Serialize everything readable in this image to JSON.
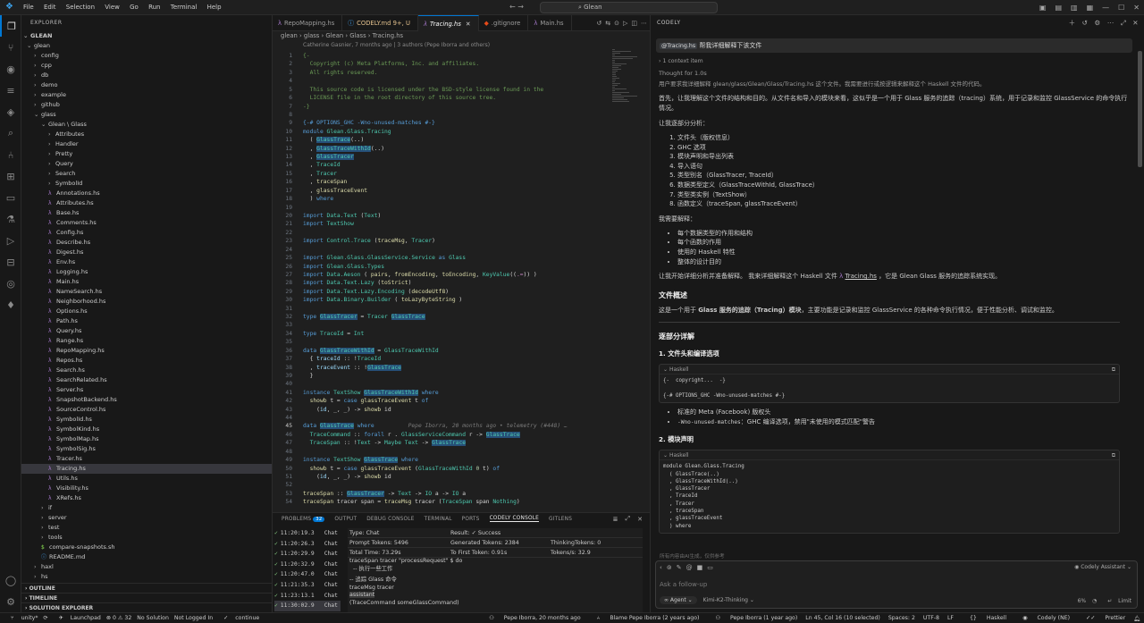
{
  "titlebar": {
    "menu": [
      "File",
      "Edit",
      "Selection",
      "View",
      "Go",
      "Run",
      "Terminal",
      "Help"
    ],
    "search_text": "Glean"
  },
  "explorer": {
    "title": "EXPLORER",
    "root": "GLEAN",
    "items": [
      {
        "label": "glean",
        "depth": 0,
        "kind": "folder-open"
      },
      {
        "label": "config",
        "depth": 1,
        "kind": "folder"
      },
      {
        "label": "cpp",
        "depth": 1,
        "kind": "folder"
      },
      {
        "label": "db",
        "depth": 1,
        "kind": "folder"
      },
      {
        "label": "demo",
        "depth": 1,
        "kind": "folder"
      },
      {
        "label": "example",
        "depth": 1,
        "kind": "folder"
      },
      {
        "label": "github",
        "depth": 1,
        "kind": "folder"
      },
      {
        "label": "glass",
        "depth": 1,
        "kind": "folder-open"
      },
      {
        "label": "Glean \\ Glass",
        "depth": 2,
        "kind": "folder-open"
      },
      {
        "label": "Attributes",
        "depth": 3,
        "kind": "folder"
      },
      {
        "label": "Handler",
        "depth": 3,
        "kind": "folder"
      },
      {
        "label": "Pretty",
        "depth": 3,
        "kind": "folder"
      },
      {
        "label": "Query",
        "depth": 3,
        "kind": "folder"
      },
      {
        "label": "Search",
        "depth": 3,
        "kind": "folder"
      },
      {
        "label": "SymbolId",
        "depth": 3,
        "kind": "folder"
      },
      {
        "label": "Annotations.hs",
        "depth": 3,
        "kind": "hs"
      },
      {
        "label": "Attributes.hs",
        "depth": 3,
        "kind": "hs"
      },
      {
        "label": "Base.hs",
        "depth": 3,
        "kind": "hs"
      },
      {
        "label": "Comments.hs",
        "depth": 3,
        "kind": "hs"
      },
      {
        "label": "Config.hs",
        "depth": 3,
        "kind": "hs"
      },
      {
        "label": "Describe.hs",
        "depth": 3,
        "kind": "hs"
      },
      {
        "label": "Digest.hs",
        "depth": 3,
        "kind": "hs"
      },
      {
        "label": "Env.hs",
        "depth": 3,
        "kind": "hs"
      },
      {
        "label": "Logging.hs",
        "depth": 3,
        "kind": "hs"
      },
      {
        "label": "Main.hs",
        "depth": 3,
        "kind": "hs"
      },
      {
        "label": "NameSearch.hs",
        "depth": 3,
        "kind": "hs"
      },
      {
        "label": "Neighborhood.hs",
        "depth": 3,
        "kind": "hs"
      },
      {
        "label": "Options.hs",
        "depth": 3,
        "kind": "hs"
      },
      {
        "label": "Path.hs",
        "depth": 3,
        "kind": "hs"
      },
      {
        "label": "Query.hs",
        "depth": 3,
        "kind": "hs"
      },
      {
        "label": "Range.hs",
        "depth": 3,
        "kind": "hs"
      },
      {
        "label": "RepoMapping.hs",
        "depth": 3,
        "kind": "hs"
      },
      {
        "label": "Repos.hs",
        "depth": 3,
        "kind": "hs"
      },
      {
        "label": "Search.hs",
        "depth": 3,
        "kind": "hs"
      },
      {
        "label": "SearchRelated.hs",
        "depth": 3,
        "kind": "hs"
      },
      {
        "label": "Server.hs",
        "depth": 3,
        "kind": "hs"
      },
      {
        "label": "SnapshotBackend.hs",
        "depth": 3,
        "kind": "hs"
      },
      {
        "label": "SourceControl.hs",
        "depth": 3,
        "kind": "hs"
      },
      {
        "label": "SymbolId.hs",
        "depth": 3,
        "kind": "hs"
      },
      {
        "label": "SymbolKind.hs",
        "depth": 3,
        "kind": "hs"
      },
      {
        "label": "SymbolMap.hs",
        "depth": 3,
        "kind": "hs"
      },
      {
        "label": "SymbolSig.hs",
        "depth": 3,
        "kind": "hs"
      },
      {
        "label": "Tracer.hs",
        "depth": 3,
        "kind": "hs"
      },
      {
        "label": "Tracing.hs",
        "depth": 3,
        "kind": "hs",
        "selected": true
      },
      {
        "label": "Utils.hs",
        "depth": 3,
        "kind": "hs"
      },
      {
        "label": "Visibility.hs",
        "depth": 3,
        "kind": "hs"
      },
      {
        "label": "XRefs.hs",
        "depth": 3,
        "kind": "hs"
      },
      {
        "label": "if",
        "depth": 2,
        "kind": "folder"
      },
      {
        "label": "server",
        "depth": 2,
        "kind": "folder"
      },
      {
        "label": "test",
        "depth": 2,
        "kind": "folder"
      },
      {
        "label": "tools",
        "depth": 2,
        "kind": "folder"
      },
      {
        "label": "compare-snapshots.sh",
        "depth": 2,
        "kind": "sh"
      },
      {
        "label": "README.md",
        "depth": 2,
        "kind": "md"
      },
      {
        "label": "haxl",
        "depth": 1,
        "kind": "folder"
      },
      {
        "label": "hs",
        "depth": 1,
        "kind": "folder"
      }
    ],
    "sections": [
      "OUTLINE",
      "TIMELINE",
      "SOLUTION EXPLORER"
    ]
  },
  "tabs": [
    {
      "label": "RepoMapping.hs",
      "icon": "hs"
    },
    {
      "label": "CODELY.md",
      "icon": "md",
      "dirty": "9+, U"
    },
    {
      "label": "Tracing.hs",
      "icon": "hs",
      "active": true
    },
    {
      "label": ".gitignore",
      "icon": "git"
    },
    {
      "label": "Main.hs",
      "icon": "hs"
    }
  ],
  "breadcrumb": "glean  ›  glass  ›  Glean  ›  Glass  ›  Tracing.hs",
  "blame": "Catherine Gasnier, 7 months ago | 3 authors (Pepe Iborra and others)",
  "current_line": 45,
  "code_lines": [
    {
      "n": 1,
      "html": "<span class='c'>{-</span>"
    },
    {
      "n": 2,
      "html": "<span class='c'>  Copyright (c) Meta Platforms, Inc. and affiliates.</span>"
    },
    {
      "n": 3,
      "html": "<span class='c'>  All rights reserved.</span>"
    },
    {
      "n": 4,
      "html": ""
    },
    {
      "n": 5,
      "html": "<span class='c'>  This source code is licensed under the BSD-style license found in the</span>"
    },
    {
      "n": 6,
      "html": "<span class='c'>  LICENSE file in the root directory of this source tree.</span>"
    },
    {
      "n": 7,
      "html": "<span class='c'>-}</span>"
    },
    {
      "n": 8,
      "html": ""
    },
    {
      "n": 9,
      "html": "<span class='k'>{-# OPTIONS_GHC -Wno-unused-matches #-}</span>"
    },
    {
      "n": 10,
      "html": "<span class='k'>module</span> <span class='t'>Glean.Glass.Tracing</span>"
    },
    {
      "n": 11,
      "html": "  ( <span class='t hl'>GlassTrace</span>(..)"
    },
    {
      "n": 12,
      "html": "  , <span class='t hl'>GlassTraceWithId</span>(..)"
    },
    {
      "n": 13,
      "html": "  , <span class='t hl'>GlassTracer</span>"
    },
    {
      "n": 14,
      "html": "  , <span class='t'>TraceId</span>"
    },
    {
      "n": 15,
      "html": "  , <span class='t'>Tracer</span>"
    },
    {
      "n": 16,
      "html": "  , <span class='f'>traceSpan</span>"
    },
    {
      "n": 17,
      "html": "  , <span class='f'>glassTraceEvent</span>"
    },
    {
      "n": 18,
      "html": "  ) <span class='k'>where</span>"
    },
    {
      "n": 19,
      "html": ""
    },
    {
      "n": 20,
      "html": "<span class='k'>import</span> <span class='t'>Data.Text</span> (<span class='t'>Text</span>)"
    },
    {
      "n": 21,
      "html": "<span class='k'>import</span> <span class='t'>TextShow</span>"
    },
    {
      "n": 22,
      "html": ""
    },
    {
      "n": 23,
      "html": "<span class='k'>import</span> <span class='t'>Control.Trace</span> (<span class='f'>traceMsg</span>, <span class='t'>Tracer</span>)"
    },
    {
      "n": 24,
      "html": ""
    },
    {
      "n": 25,
      "html": "<span class='k'>import</span> <span class='t'>Glean.Glass.GlassService.Service</span> <span class='k'>as</span> <span class='t'>Glass</span>"
    },
    {
      "n": 26,
      "html": "<span class='k'>import</span> <span class='t'>Glean.Glass.Types</span>"
    },
    {
      "n": 27,
      "html": "<span class='k'>import</span> <span class='t'>Data.Aeson</span> ( <span class='f'>pairs</span>, <span class='f'>fromEncoding</span>, <span class='f'>toEncoding</span>, <span class='t'>KeyValue</span>((<span class='p'>.=</span>)) )"
    },
    {
      "n": 28,
      "html": "<span class='k'>import</span> <span class='t'>Data.Text.Lazy</span> (<span class='f'>toStrict</span>)"
    },
    {
      "n": 29,
      "html": "<span class='k'>import</span> <span class='t'>Data.Text.Lazy.Encoding</span> (<span class='f'>decodeUtf8</span>)"
    },
    {
      "n": 30,
      "html": "<span class='k'>import</span> <span class='t'>Data.Binary.Builder</span> ( <span class='f'>toLazyByteString</span> )"
    },
    {
      "n": 31,
      "html": ""
    },
    {
      "n": 32,
      "html": "<span class='k'>type</span> <span class='t hl'>GlassTracer</span> = <span class='t'>Tracer</span> <span class='t hl'>GlassTrace</span>"
    },
    {
      "n": 33,
      "html": ""
    },
    {
      "n": 34,
      "html": "<span class='k'>type</span> <span class='t'>TraceId</span> = <span class='t'>Int</span>"
    },
    {
      "n": 35,
      "html": ""
    },
    {
      "n": 36,
      "html": "<span class='k'>data</span> <span class='t hl'>GlassTraceWithId</span> = <span class='t'>GlassTraceWithId</span>"
    },
    {
      "n": 37,
      "html": "  { <span class='v'>traceId</span> :: !<span class='t'>TraceId</span>"
    },
    {
      "n": 38,
      "html": "  , <span class='v'>traceEvent</span> :: !<span class='t hl'>GlassTrace</span>"
    },
    {
      "n": 39,
      "html": "  }"
    },
    {
      "n": 40,
      "html": ""
    },
    {
      "n": 41,
      "html": "<span class='k'>instance</span> <span class='t'>TextShow</span> <span class='t hl'>GlassTraceWithId</span> <span class='k'>where</span>"
    },
    {
      "n": 42,
      "html": "  <span class='f'>showb</span> t = <span class='k'>case</span> <span class='f'>glassTraceEvent</span> t <span class='k'>of</span>"
    },
    {
      "n": 43,
      "html": "    (<span class='v'>id</span>, _, _) -> <span class='f'>showb</span> id"
    },
    {
      "n": 44,
      "html": ""
    },
    {
      "n": 45,
      "html": "<span class='k'>data</span> <span class='t hl'>GlassTrace</span> <span class='k'>where</span>          <span class='g'>Pepe Iborra, 20 months ago • telemetry (#448) …</span>"
    },
    {
      "n": 46,
      "html": "  <span class='t'>TraceCommand</span> :: <span class='k'>forall</span> r . <span class='t'>GlassServiceCommand</span> r -> <span class='t hl'>GlassTrace</span>"
    },
    {
      "n": 47,
      "html": "  <span class='t'>TraceSpan</span> :: !<span class='t'>Text</span> -> <span class='t'>Maybe</span> <span class='t'>Text</span> -> <span class='t hl'>GlassTrace</span>"
    },
    {
      "n": 48,
      "html": ""
    },
    {
      "n": 49,
      "html": "<span class='k'>instance</span> <span class='t'>TextShow</span> <span class='t hl'>GlassTrace</span> <span class='k'>where</span>"
    },
    {
      "n": 50,
      "html": "  <span class='f'>showb</span> t = <span class='k'>case</span> <span class='f'>glassTraceEvent</span> (<span class='t'>GlassTraceWithId</span> <span class='n'>0</span> t) <span class='k'>of</span>"
    },
    {
      "n": 51,
      "html": "    (<span class='v'>id</span>, _, _) -> <span class='f'>showb</span> id"
    },
    {
      "n": 52,
      "html": ""
    },
    {
      "n": 53,
      "html": "<span class='f'>traceSpan</span> :: <span class='t hl'>GlassTracer</span> -> <span class='t'>Text</span> -> <span class='t'>IO</span> a -> <span class='t'>IO</span> a"
    },
    {
      "n": 54,
      "html": "<span class='f'>traceSpan</span> tracer span = <span class='f'>traceMsg</span> tracer (<span class='t'>TraceSpan</span> span <span class='t'>Nothing</span>)"
    }
  ],
  "panel": {
    "tabs": [
      "PROBLEMS",
      "OUTPUT",
      "DEBUG CONSOLE",
      "TERMINAL",
      "PORTS",
      "CODELY CONSOLE",
      "GITLENS"
    ],
    "problems_badge": "32",
    "active_tab": "CODELY CONSOLE",
    "log": [
      {
        "time": "11:20:19.3",
        "label": "Chat"
      },
      {
        "time": "11:20:26.3",
        "label": "Chat"
      },
      {
        "time": "11:20:29.9",
        "label": "Chat"
      },
      {
        "time": "11:20:32.9",
        "label": "Chat"
      },
      {
        "time": "11:20:47.0",
        "label": "Chat"
      },
      {
        "time": "11:21:35.3",
        "label": "Chat"
      },
      {
        "time": "11:23:13.1",
        "label": "Chat"
      },
      {
        "time": "11:30:02.9",
        "label": "Chat",
        "selected": true
      }
    ],
    "detail": {
      "type": "Type: Chat",
      "result": "Result: ✓ Success",
      "prompt_tokens": "Prompt Tokens: 5496",
      "generated_tokens": "Generated Tokens: 2384",
      "thinking_tokens": "ThinkingTokens: 0",
      "total_time": "Total Time: 73.29s",
      "first_token": "To First Token: 0.91s",
      "tokens_per_s": "Tokens/s: 32.9",
      "body_1": "traceSpan tracer \"processRequest\" $ do\n  -- 执行一些工作",
      "body_2": "-- 追踪 Glass 命令\ntraceMsg tracer",
      "assistant": "assistant",
      "body_3": "(TraceCommand someGlassCommand)"
    }
  },
  "chat": {
    "title": "CODELY",
    "user_ref": "@Tracing.hs",
    "user_text": " 帮我详细解释下该文件",
    "context_items": "1 context item",
    "thought_label": "Thought for 1.0s",
    "thought_text": "用户要求我详细解释 glean/glass/Glean/Glass/Tracing.hs 这个文件。我需要进行或按逻辑来解释这个 Haskell 文件的代码。",
    "para1": "首先，让我理解这个文件的结构和目的。从文件名和导入的模块来看，这似乎是一个用于 Glass 服务的追踪（tracing）系统，用于记录和监控 GlassService 的命令执行情况。",
    "para2": "让我逐部分分析：",
    "analysis": [
      "文件头（版权信息）",
      "GHC 选项",
      "模块声明和导出列表",
      "导入语句",
      "类型别名（GlassTracer, TraceId）",
      "数据类型定义（GlassTraceWithId, GlassTrace）",
      "类型类实例（TextShow）",
      "函数定义（traceSpan, glassTraceEvent）"
    ],
    "para3": "我需要解释：",
    "explain": [
      "每个数据类型的作用和结构",
      "每个函数的作用",
      "使用的 Haskell 特性",
      "整体的设计目的"
    ],
    "para4_a": "让我开始详细分析并准备解释。 我来详细解释这个 Haskell 文件 ",
    "para4_link": "Tracing.hs",
    "para4_b": " ，它是 Glean Glass 服务的追踪系统实现。",
    "h_overview": "文件概述",
    "overview_a": "这是一个用于 ",
    "overview_b": "Glass 服务的追踪（Tracing）模块",
    "overview_c": "，主要功能是记录和监控 GlassService 的各种命令执行情况，便于性能分析、调试和监控。",
    "h_detail": "逐部分详解",
    "h_1": "1. 文件头和编译选项",
    "code1_lang": "Haskell",
    "code1": "{-  copyright...  -}\n\n{-# OPTIONS_GHC -Wno-unused-matches #-}",
    "b1": "标准的 Meta (Facebook) 版权头",
    "b2_code": "-Wno-unused-matches",
    "b2_text": "：GHC 编译选项，禁用\"未使用的模式匹配\"警告",
    "h_2": "2. 模块声明",
    "code2_lang": "Haskell",
    "code2": "module Glean.Glass.Tracing\n  ( GlassTrace(..)\n  , GlassTraceWithId(..)\n  , GlassTracer\n  , TraceId\n  , Tracer\n  , traceSpan\n  , glassTraceEvent\n  ) where",
    "ai_hint": "所有内容由AI生成，仅供参考",
    "input_placeholder": "Ask a follow-up",
    "assistant_label": "Codely Assistant",
    "agent_label": "Agent",
    "model_label": "Kimi-K2-Thinking",
    "usage": "6%",
    "limit_label": "Limit"
  },
  "statusbar": {
    "left": [
      "unity*",
      "Launchpad",
      "⊗ 0 ⚠ 32",
      "No Solution",
      "Not Logged In",
      "continue"
    ],
    "right": [
      "Pepe Iborra, 20 months ago",
      "Blame Pepe Iborra (2 years ago)",
      "Pepe Iborra (1 year ago)",
      "Ln 45, Col 16 (10 selected)",
      "Spaces: 2",
      "UTF-8",
      "LF",
      "Haskell",
      "Codely (NE)",
      "Prettier"
    ]
  }
}
